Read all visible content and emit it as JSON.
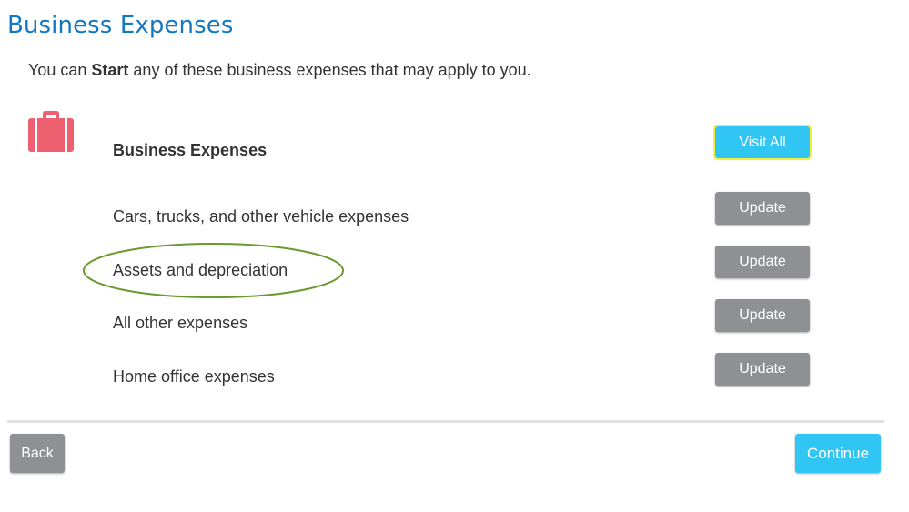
{
  "header": {
    "title": "Business Expenses"
  },
  "intro": {
    "prefix": "You can ",
    "emphasis": "Start",
    "suffix": " any of these business expenses that may apply to you."
  },
  "section": {
    "icon": "briefcase-icon",
    "icon_color": "#ee5f6f",
    "heading": "Business Expenses",
    "visit_all_label": "Visit All"
  },
  "rows": [
    {
      "label": "Cars, trucks, and other vehicle expenses",
      "button": "Update"
    },
    {
      "label": "Assets and depreciation",
      "button": "Update"
    },
    {
      "label": "All other expenses",
      "button": "Update"
    },
    {
      "label": "Home office expenses",
      "button": "Update"
    }
  ],
  "annotation": {
    "highlighted_row": "Assets and depreciation",
    "color": "#6a9a2d"
  },
  "footer": {
    "back_label": "Back",
    "continue_label": "Continue"
  },
  "colors": {
    "title": "#1478c1",
    "primary_button": "#31c5f4",
    "secondary_button": "#8e9094",
    "focus_outline": "#f4ef3c"
  }
}
